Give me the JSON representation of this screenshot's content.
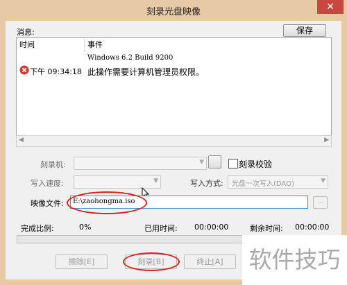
{
  "window": {
    "title": "刻录光盘映像",
    "close_glyph": "✕"
  },
  "messages": {
    "label": "消息:",
    "save_label": "保存",
    "columns": [
      "时间",
      "事件"
    ],
    "rows": [
      {
        "time": "",
        "event": "Windows 6.2 Build 9200"
      },
      {
        "time": "下午 09:34:18",
        "event": "此操作需要计算机管理员权限。",
        "icon": "error-icon"
      }
    ]
  },
  "burner": {
    "label": "刻录机:",
    "value": "",
    "verify_label": "刻录校验",
    "verify_checked": false
  },
  "speed": {
    "label": "写入速度:",
    "value": ""
  },
  "write_mode": {
    "label": "写入方式:",
    "value": "光盘一次写入(DAO)"
  },
  "image_file": {
    "label": "映像文件:",
    "value": "E:\\zaohongma.iso",
    "browse_label": "..."
  },
  "progress": {
    "ratio_label": "完成比例:",
    "ratio_value": "0%",
    "elapsed_label": "已用时间:",
    "elapsed_value": "00:00:00",
    "remaining_label": "剩余时间:",
    "remaining_value": "00:00:00",
    "fraction": 0
  },
  "buttons": {
    "erase": "擦除[E]",
    "burn": "刻录[B]",
    "stop": "终止[A]"
  },
  "watermark": "软件技巧",
  "colors": {
    "frame": "#e8c9a6",
    "close": "#c7483f",
    "annotation": "#d92020",
    "error": "#d8342c"
  }
}
